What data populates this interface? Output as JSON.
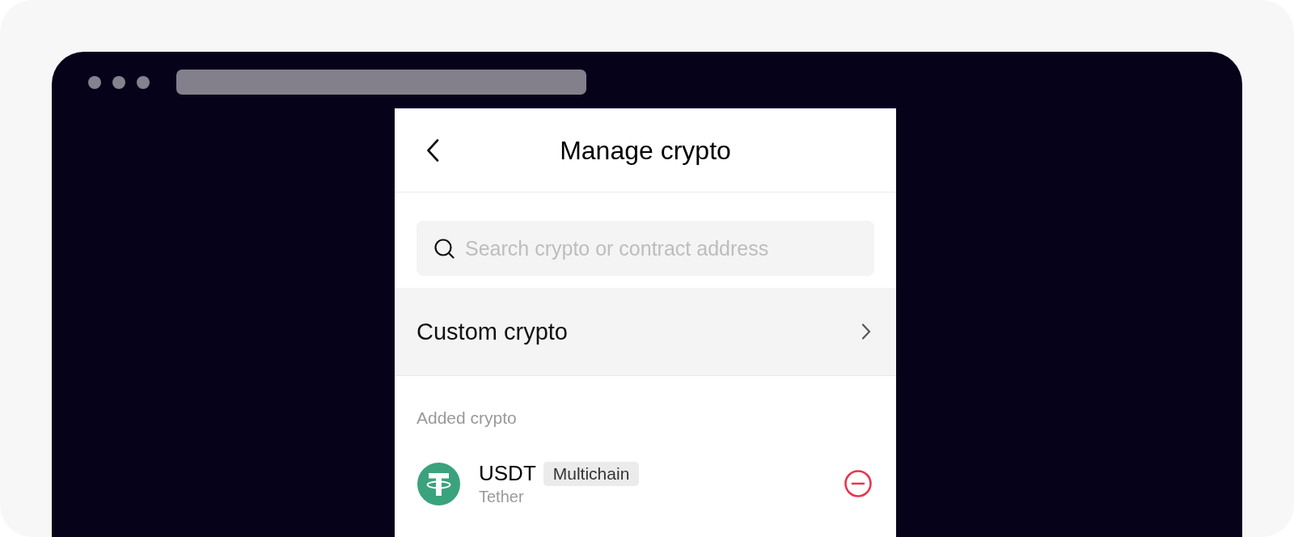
{
  "screen": {
    "title": "Manage crypto",
    "search": {
      "placeholder": "Search crypto or contract address"
    },
    "custom_crypto": {
      "label": "Custom crypto"
    },
    "added_section": {
      "label": "Added crypto",
      "assets": [
        {
          "symbol": "USDT",
          "badge": "Multichain",
          "name": "Tether"
        }
      ]
    }
  }
}
